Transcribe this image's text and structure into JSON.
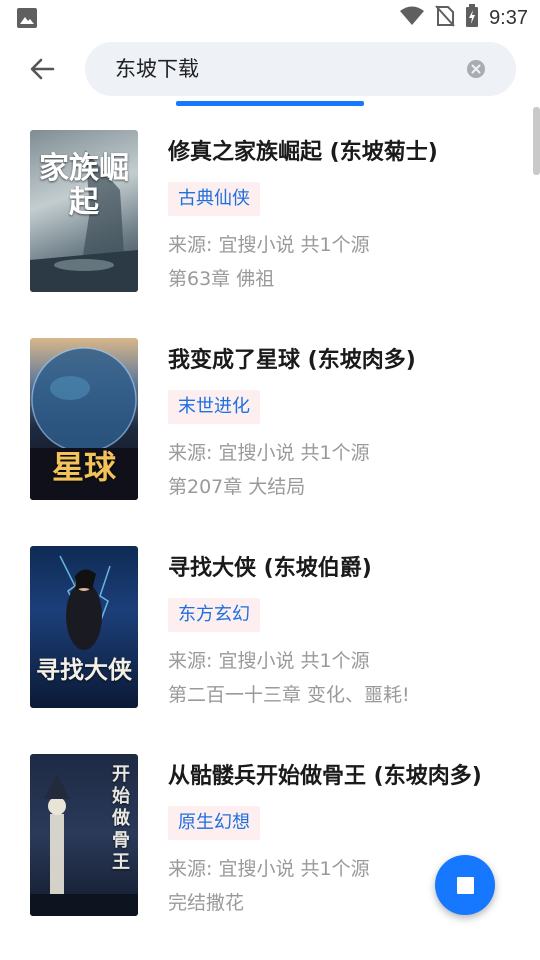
{
  "status_bar": {
    "time": "9:37",
    "icons": [
      "image-icon",
      "wifi-icon",
      "no-sim-icon",
      "battery-charging-icon"
    ]
  },
  "search": {
    "query": "东坡下载",
    "back_icon": "arrow-left-icon",
    "clear_icon": "clear-circle-icon"
  },
  "accent_color": "#1677ff",
  "books": [
    {
      "title": "修真之家族崛起 (东坡菊士)",
      "tag": "古典仙侠",
      "source": "来源: 宜搜小说  共1个源",
      "chapter": "第63章 佛祖",
      "cover_text": "家族崛起"
    },
    {
      "title": "我变成了星球 (东坡肉多)",
      "tag": "末世进化",
      "source": "来源: 宜搜小说  共1个源",
      "chapter": "第207章 大结局",
      "cover_text": "星球"
    },
    {
      "title": "寻找大侠 (东坡伯爵)",
      "tag": "东方玄幻",
      "source": "来源: 宜搜小说  共1个源",
      "chapter": "第二百一十三章 变化、噩耗!",
      "cover_text": "寻找大侠"
    },
    {
      "title": "从骷髅兵开始做骨王 (东坡肉多)",
      "tag": "原生幻想",
      "source": "来源: 宜搜小说  共1个源",
      "chapter": "完结撒花",
      "cover_text": "开始做骨王"
    }
  ],
  "fab": {
    "icon": "stop-icon"
  }
}
